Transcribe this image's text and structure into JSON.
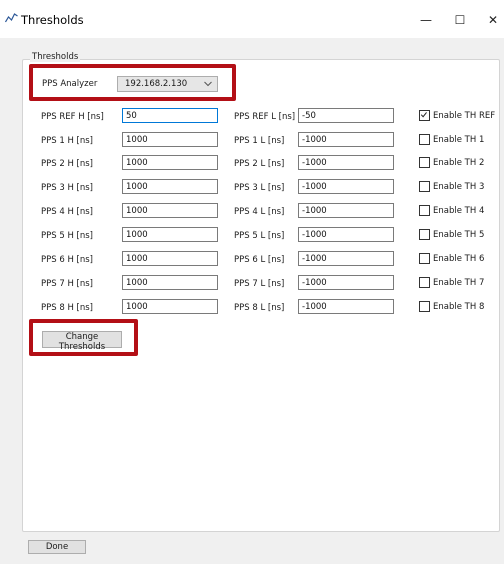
{
  "window": {
    "title": "Thresholds",
    "minimize_glyph": "—",
    "maximize_glyph": "☐",
    "close_glyph": "✕",
    "icon": "chart-line-icon"
  },
  "group": {
    "title": "Thresholds"
  },
  "analyzer": {
    "label": "PPS Analyzer",
    "selected": "192.168.2.130"
  },
  "ref": {
    "h_label": "PPS REF H [ns]",
    "h_value": "50",
    "l_label": "PPS REF L [ns]",
    "l_value": "-50",
    "enable_label": "Enable TH REF",
    "enabled": true
  },
  "rows": [
    {
      "h_label": "PPS 1 H [ns]",
      "h_value": "1000",
      "l_label": "PPS 1 L [ns]",
      "l_value": "-1000",
      "enable_label": "Enable TH 1",
      "enabled": false
    },
    {
      "h_label": "PPS 2 H [ns]",
      "h_value": "1000",
      "l_label": "PPS 2 L [ns]",
      "l_value": "-1000",
      "enable_label": "Enable TH 2",
      "enabled": false
    },
    {
      "h_label": "PPS 3 H [ns]",
      "h_value": "1000",
      "l_label": "PPS 3 L [ns]",
      "l_value": "-1000",
      "enable_label": "Enable TH 3",
      "enabled": false
    },
    {
      "h_label": "PPS 4 H [ns]",
      "h_value": "1000",
      "l_label": "PPS 4 L [ns]",
      "l_value": "-1000",
      "enable_label": "Enable TH 4",
      "enabled": false
    },
    {
      "h_label": "PPS 5 H [ns]",
      "h_value": "1000",
      "l_label": "PPS 5 L [ns]",
      "l_value": "-1000",
      "enable_label": "Enable TH 5",
      "enabled": false
    },
    {
      "h_label": "PPS 6 H [ns]",
      "h_value": "1000",
      "l_label": "PPS 6 L [ns]",
      "l_value": "-1000",
      "enable_label": "Enable TH 6",
      "enabled": false
    },
    {
      "h_label": "PPS 7 H [ns]",
      "h_value": "1000",
      "l_label": "PPS 7 L [ns]",
      "l_value": "-1000",
      "enable_label": "Enable TH 7",
      "enabled": false
    },
    {
      "h_label": "PPS 8 H [ns]",
      "h_value": "1000",
      "l_label": "PPS 8 L [ns]",
      "l_value": "-1000",
      "enable_label": "Enable TH 8",
      "enabled": false
    }
  ],
  "change_button": {
    "label": "Change Thresholds"
  },
  "done_button": {
    "label": "Done"
  },
  "colors": {
    "highlight": "#b30f16",
    "focus_border": "#0078d7",
    "dialog_bg": "#f0f0f0"
  }
}
